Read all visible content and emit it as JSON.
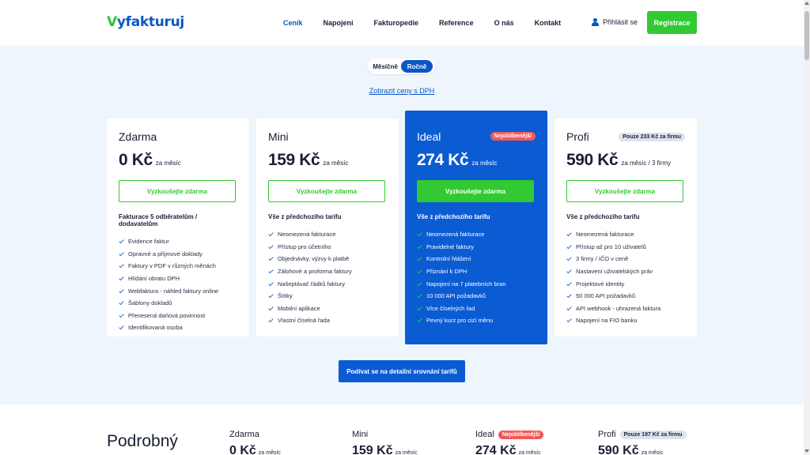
{
  "header": {
    "logo_v": "V",
    "logo_text": "yfakturuj",
    "nav": [
      "Ceník",
      "Napojení",
      "Fakturopedie",
      "Reference",
      "O nás",
      "Kontakt"
    ],
    "login": "Přihlásit se",
    "register": "Registrace"
  },
  "billing": {
    "monthly": "Měsíčně",
    "yearly": "Ročně",
    "vat_link": "Zobrazit ceny s DPH"
  },
  "plans": [
    {
      "name": "Zdarma",
      "price": "0 Kč",
      "period": "za měsíc",
      "button": "Vyzkoušejte zdarma",
      "subtitle": "Fakturace 5 odběratelům / dodavatelům",
      "features": [
        "Evidence faktur",
        "Opravné a příjmové doklady",
        "Faktury v PDF v různých měnách",
        "Hlídání obratu DPH",
        "Webfaktura - náhled faktury online",
        "Šablony dokladů",
        "Přenesená daňová povinnost",
        "Identifikovaná osoba"
      ]
    },
    {
      "name": "Mini",
      "price": "159 Kč",
      "period": "za měsíc",
      "button": "Vyzkoušejte zdarma",
      "subtitle": "Vše z předchozího tarifu",
      "features": [
        "Neomezená fakturace",
        "Přístup pro účetního",
        "Objednávky, výzvy k platbě",
        "Zálohové a proforma faktury",
        "Našeptávač řádků faktury",
        "Štítky",
        "Mobilní aplikace",
        "Vlastní číselná řada"
      ]
    },
    {
      "name": "Ideal",
      "badge": "Nejoblíbenější",
      "price": "274 Kč",
      "period": "za měsíc",
      "button": "Vyzkoušejte zdarma",
      "subtitle": "Vše z předchozího tarifu",
      "features": [
        "Neomezená fakturace",
        "Pravidelné faktury",
        "Kontrolní hlášení",
        "Přiznání k DPH",
        "Napojení na 7 platebních bran",
        "10 000 API požadavků",
        "Více číselných řad",
        "Pevný kurz pro cizí měnu"
      ]
    },
    {
      "name": "Profi",
      "badge": "Pouze 233 Kč za firmu",
      "price": "590 Kč",
      "period": "za měsíc / 3 firmy",
      "button": "Vyzkoušejte zdarma",
      "subtitle": "Vše z předchozího tarifu",
      "features": [
        "Neomezená fakturace",
        "Přístup až pro 10 uživatelů",
        "3 firmy / IČO v ceně",
        "Nastavení uživatelských práv",
        "Projektové identity",
        "50 000 API požadavků",
        "API webhook - uhrazená faktura",
        "Napojení na FIO banku"
      ]
    }
  ],
  "compare_button": "Podívat se na detailní srovnání tarifů",
  "detail": {
    "title": "Podrobný",
    "cols": [
      {
        "name": "Zdarma",
        "price": "0 Kč",
        "period": "za měsíc"
      },
      {
        "name": "Mini",
        "price": "159 Kč",
        "period": "za měsíc"
      },
      {
        "name": "Ideal",
        "badge": "Nejoblíbenější",
        "price": "274 Kč",
        "period": "za měsíc"
      },
      {
        "name": "Profi",
        "badge": "Pouze 197 Kč za firmu",
        "price": "590 Kč",
        "period": "za měsíc"
      }
    ]
  },
  "colors": {
    "brand_blue": "#0b5bd3",
    "brand_green": "#32c932",
    "badge_red": "#f05a5a",
    "background": "#eef5fd"
  }
}
